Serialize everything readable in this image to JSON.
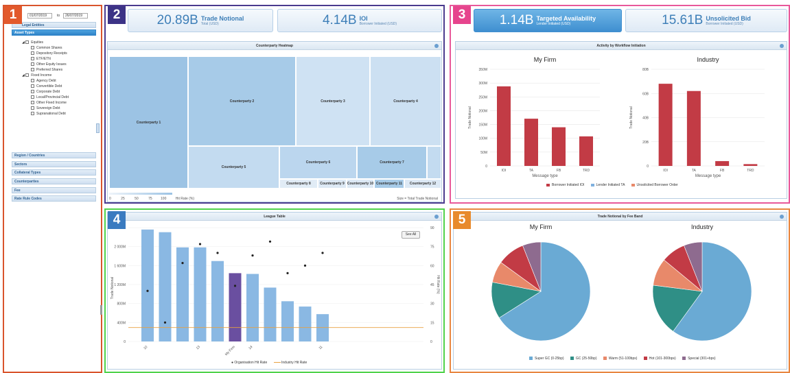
{
  "badges": [
    "1",
    "2",
    "3",
    "4",
    "5"
  ],
  "filters": {
    "date_from": "01/07/2019",
    "date_to_label": "to",
    "date_to": "26/07/2019",
    "legal_entities": "Legal Entities",
    "asset_types": "Asset Types",
    "equities": "Equities",
    "equity_items": [
      "Common Shares",
      "Depository Receipts",
      "ETF/ETN",
      "Other Equity Issues",
      "Preferred Shares"
    ],
    "fixed_income": "Fixed Income",
    "fi_items": [
      "Agency Debt",
      "Convertible Debt",
      "Corporate Debt",
      "Local/Provincial Debt",
      "Other Fixed Income",
      "Sovereign Debt",
      "Supranational Debt"
    ],
    "sections": [
      "Region / Countries",
      "Sectors",
      "Collateral Types",
      "Counterparties",
      "Fee",
      "Rate Rule Codes"
    ]
  },
  "kpis": [
    {
      "value": "20.89B",
      "label": "Trade Notional",
      "sub": "Total (USD)"
    },
    {
      "value": "4.14B",
      "label": "IOI",
      "sub": "Borrower Initiated (USD)"
    },
    {
      "value": "1.14B",
      "label": "Targeted Availability",
      "sub": "Lender Initiated (USD)"
    },
    {
      "value": "15.61B",
      "label": "Unsolicited Bid",
      "sub": "Borrower Initiated (USD)"
    }
  ],
  "heatmap": {
    "title": "Counterparty Heatmap",
    "cells": [
      "Counterparty 1",
      "Counterparty 2",
      "Counterparty 3",
      "Counterparty 4",
      "Counterparty 5",
      "Counterparty 6",
      "Counterparty 7",
      "Counterparty 8",
      "Counterparty 9",
      "Counterparty 10",
      "Counterparty 11",
      "Counterparty 12"
    ],
    "scale_ticks": [
      "0",
      "25",
      "50",
      "75",
      "100"
    ],
    "scale_label": "Hit Rate (%)",
    "size_label": "Size = Total Trade Notional"
  },
  "workflow": {
    "title": "Activity by Workflow Initiation",
    "legend": [
      "Borrower Initiated IOI",
      "Lender Initiated TA",
      "Unsolicited Borrower Order"
    ],
    "legend_colors": [
      "#c23b45",
      "#7fb0de",
      "#e8896a"
    ]
  },
  "league": {
    "title": "League Table",
    "see_all": "See All",
    "legend": [
      "Organisation Hit Rate",
      "Industry Hit Rate"
    ]
  },
  "fee": {
    "title": "Trade Notional by Fee Band",
    "legend": [
      "Super GC (0-25bp)",
      "GC (25-50bp)",
      "Warm (51-100bps)",
      "Hot (101-300bps)",
      "Special (301+bps)"
    ],
    "colors": [
      "#6aaad4",
      "#2f8f86",
      "#e8896a",
      "#c23b45",
      "#8e6b8f"
    ]
  },
  "chart_data": [
    {
      "type": "bar",
      "title": "My Firm",
      "categories": [
        "IOI",
        "TA",
        "FB",
        "TRD"
      ],
      "values": [
        288,
        171,
        140,
        107
      ],
      "ylabel": "Trade Notional",
      "xlabel": "Message type",
      "yticks": [
        "0",
        "50M",
        "100M",
        "150M",
        "200M",
        "250M",
        "300M",
        "350M"
      ],
      "ylim": [
        0,
        350
      ]
    },
    {
      "type": "bar",
      "title": "Industry",
      "categories": [
        "IOI",
        "TA",
        "FB",
        "TRD"
      ],
      "values": [
        68,
        62,
        4,
        1.5
      ],
      "ylabel": "Trade Notional",
      "xlabel": "Message type",
      "yticks": [
        "0",
        "20B",
        "40B",
        "60B",
        "80B"
      ],
      "ylim": [
        0,
        80
      ]
    },
    {
      "type": "bar",
      "title": "League Table",
      "categories": [
        "10",
        "",
        "",
        "13",
        "",
        "My Firm",
        "14",
        "",
        "",
        "",
        "11",
        ""
      ],
      "values": [
        2.95,
        2.88,
        2.48,
        2.48,
        2.12,
        1.8,
        1.78,
        1.42,
        1.06,
        0.92,
        0.72,
        0
      ],
      "hit_rate": [
        40,
        15,
        62,
        77,
        70,
        44,
        68,
        79,
        54,
        60,
        70,
        0
      ],
      "industry_hit_rate": 11,
      "ylabel": "Trade Notional",
      "y2label": "Hit Rate (%)",
      "yticks": [
        "0",
        "400M",
        "800M",
        "1 200M",
        "1 600M",
        "2 000M",
        "M"
      ],
      "y2ticks": [
        "0",
        "15",
        "30",
        "45",
        "60",
        "75",
        "90"
      ]
    },
    {
      "type": "pie",
      "title": "My Firm",
      "labels": [
        "Super GC (0-25bp)",
        "GC (25-50bp)",
        "Warm (51-100bps)",
        "Hot (101-300bps)",
        "Special (301+bps)"
      ],
      "values": [
        66,
        12,
        7,
        9,
        6
      ]
    },
    {
      "type": "pie",
      "title": "Industry",
      "labels": [
        "Super GC (0-25bp)",
        "GC (25-50bp)",
        "Warm (51-100bps)",
        "Hot (101-300bps)",
        "Special (301+bps)"
      ],
      "values": [
        60,
        17,
        9,
        8,
        6
      ]
    }
  ]
}
